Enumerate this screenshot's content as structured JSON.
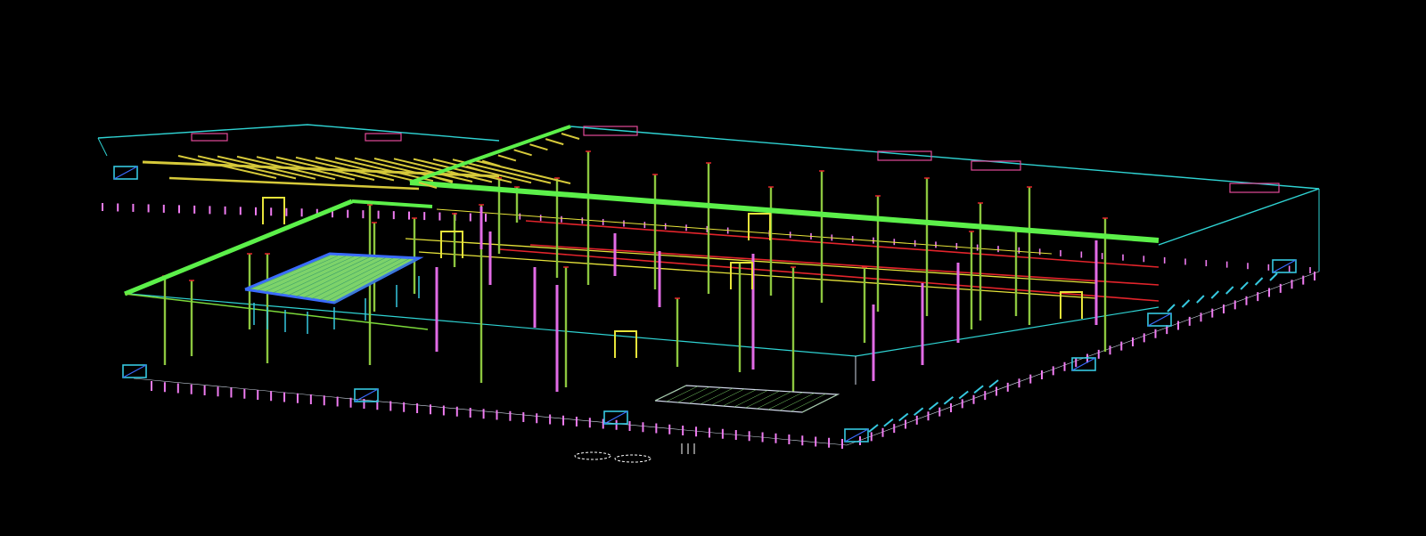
{
  "view": {
    "background": "#000000",
    "layer_colors": {
      "roof_edge": "#2fd3d3",
      "beams": "#7cd93a",
      "beams_bright": "#5cf04a",
      "columns_primary": "#8cc63f",
      "columns_secondary": "#e26be6",
      "joists": "#d6c93a",
      "bracing_red": "#e3242b",
      "bracing_yellow": "#e6e33a",
      "mezzanine_floor": "#7dd36a",
      "mezzanine_edge": "#3a6bff",
      "piers": "#f07cf2",
      "stairs": "#36c9e0",
      "gridlines": "#cfd8e6",
      "rebar_marks": "#ffffff",
      "ceiling_grid": "#d1d8ea"
    }
  }
}
